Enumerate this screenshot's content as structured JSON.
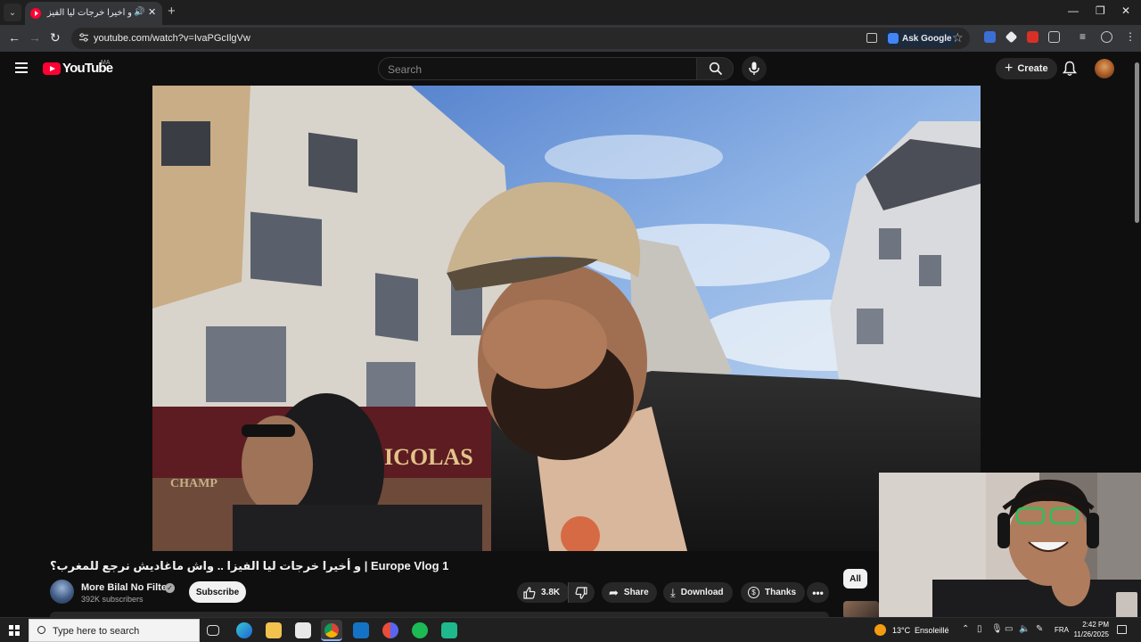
{
  "browser": {
    "tab_title": "و أخيرا خرجات ليا الفيزا .. واش ماغاديش نرجع للمغرب؟",
    "url": "youtube.com/watch?v=IvaPGcIlgVw",
    "ask_google_label": "Ask Google"
  },
  "youtube": {
    "logo_text": "YouTube",
    "region_code": "MA",
    "search_placeholder": "Search",
    "create_label": "Create"
  },
  "video": {
    "title": "و أخيرا خرجات ليا الفيزا .. واش ماغاديش نرجع للمغرب؟ | Europe Vlog 1",
    "channel_name": "More Bilal No Filter",
    "subscribers": "392K subscribers",
    "subscribe_label": "Subscribe",
    "like_count": "3.8K",
    "share_label": "Share",
    "download_label": "Download",
    "thanks_label": "Thanks",
    "storefront_sign": "ICOLAS",
    "storefront_sign_left": "CHAMP"
  },
  "sidebar": {
    "chip_all": "All"
  },
  "taskbar": {
    "search_placeholder": "Type here to search",
    "weather_temp": "13°C",
    "weather_desc": "Ensoleillé",
    "language": "FRA",
    "time": "2:42 PM",
    "date": "11/26/2025"
  },
  "colors": {
    "youtube_red": "#ff0033",
    "page_bg": "#0f0f0f",
    "pill_bg": "#272727"
  }
}
